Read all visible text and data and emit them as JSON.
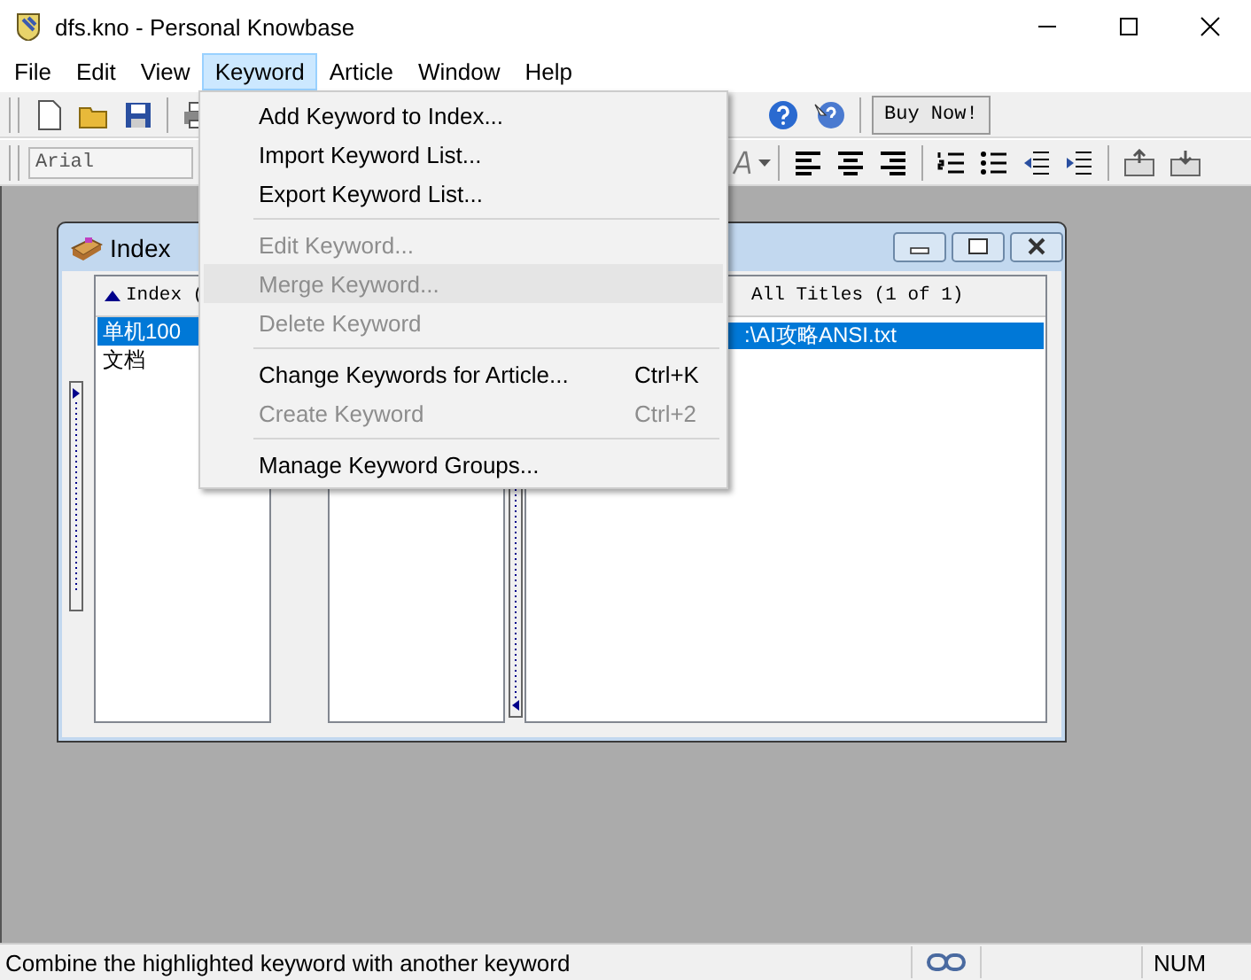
{
  "window": {
    "title": "dfs.kno - Personal Knowbase"
  },
  "menubar": [
    {
      "label": "File",
      "selected": false
    },
    {
      "label": "Edit",
      "selected": false
    },
    {
      "label": "View",
      "selected": false
    },
    {
      "label": "Keyword",
      "selected": true
    },
    {
      "label": "Article",
      "selected": false
    },
    {
      "label": "Window",
      "selected": false
    },
    {
      "label": "Help",
      "selected": false
    }
  ],
  "toolbar": {
    "buy_button": "Buy Now!",
    "font_field": {
      "value": "Arial"
    }
  },
  "keyword_menu": [
    {
      "kind": "item",
      "label": "Add Keyword to Index...",
      "disabled": false,
      "selected": false
    },
    {
      "kind": "item",
      "label": "Import Keyword List...",
      "disabled": false,
      "selected": false
    },
    {
      "kind": "item",
      "label": "Export Keyword List...",
      "disabled": false,
      "selected": false
    },
    {
      "kind": "separator"
    },
    {
      "kind": "item",
      "label": "Edit Keyword...",
      "disabled": true,
      "selected": false
    },
    {
      "kind": "item",
      "label": "Merge Keyword...",
      "disabled": true,
      "selected": true
    },
    {
      "kind": "item",
      "label": "Delete Keyword",
      "disabled": true,
      "selected": false
    },
    {
      "kind": "separator"
    },
    {
      "kind": "item",
      "label": "Change Keywords for Article...",
      "shortcut": "Ctrl+K",
      "disabled": false,
      "selected": false
    },
    {
      "kind": "item",
      "label": "Create Keyword",
      "shortcut": "Ctrl+2",
      "disabled": true,
      "selected": false
    },
    {
      "kind": "separator"
    },
    {
      "kind": "item",
      "label": "Manage Keyword Groups...",
      "disabled": false,
      "selected": false
    }
  ],
  "index_window": {
    "title": "Index",
    "keyword_list": {
      "header": "Index (",
      "rows": [
        {
          "text": "单机100",
          "selected": true
        },
        {
          "text": "文档",
          "selected": false
        }
      ]
    },
    "titles_list": {
      "header": "All Titles (1 of 1)",
      "rows": [
        {
          "text": ":\\AI攻略ANSI.txt",
          "selected": true
        }
      ]
    }
  },
  "status_bar": {
    "message": "Combine the highlighted keyword with another keyword",
    "indicator": "NUM"
  }
}
